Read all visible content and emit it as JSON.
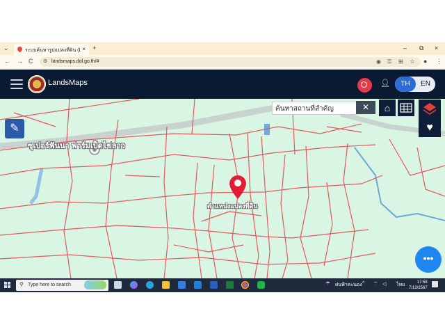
{
  "browser": {
    "tab_title": "ระบบค้นหารูปแปลงที่ดิน (LandsMa",
    "tab_close": "×",
    "new_tab": "+",
    "tab_menu": "⌄",
    "window_controls": [
      "–",
      "⧉",
      "×"
    ],
    "url": "landsmaps.dol.go.th/#",
    "nav": [
      "←",
      "→",
      "C"
    ]
  },
  "app": {
    "brand": "LandsMaps",
    "lang_th": "TH",
    "lang_en": "EN"
  },
  "map": {
    "search_placeholder": "ค้นหาสถานที่สำคัญ",
    "close_label": "✕",
    "poi_label": "ซุเปอร์ฟันนา ฟาร์มเป็ดไข่ลาว",
    "marker_label": "ตำแหน่งแปลงที่ดิน",
    "more_label": "•••",
    "colors": {
      "parcel": "#e8585c",
      "background": "#d9f5e4",
      "marker": "#e21e35",
      "river": "#6aa9d8"
    }
  },
  "taskbar": {
    "search_placeholder": "Type here to search",
    "tray_text": "ฝนฟ้าคะนอง",
    "lang": "ไทย",
    "time": "17:58",
    "date": "7/12/2567"
  }
}
